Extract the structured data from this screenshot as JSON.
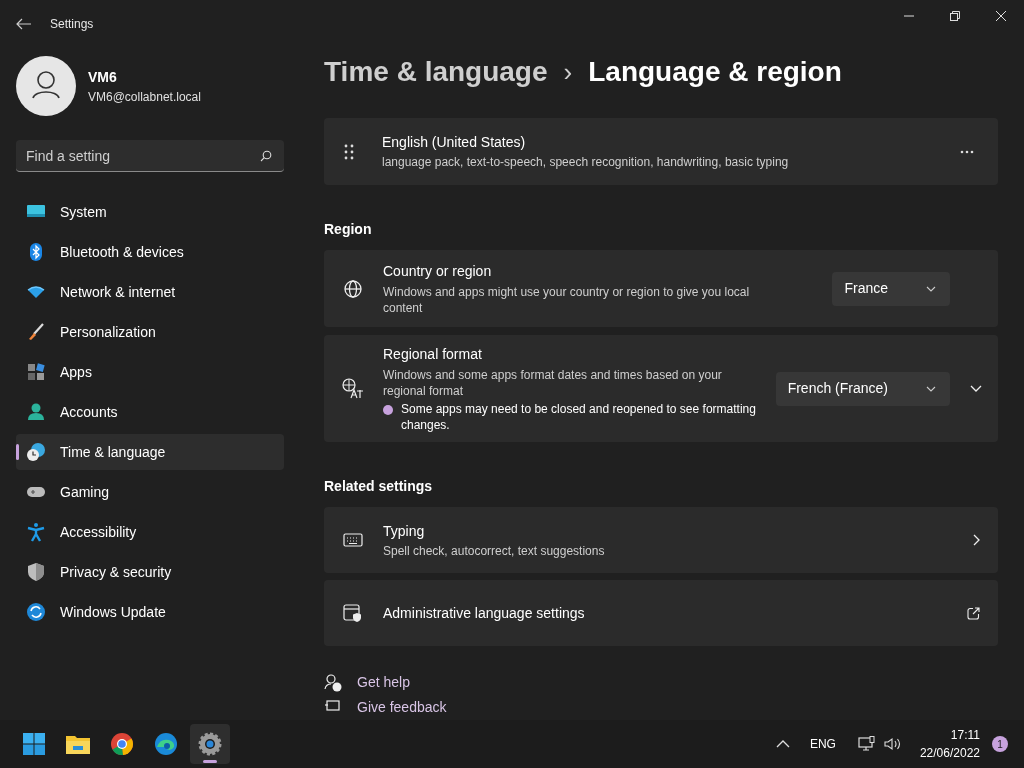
{
  "window": {
    "title": "Settings"
  },
  "user": {
    "name": "VM6",
    "email": "VM6@collabnet.local"
  },
  "search": {
    "placeholder": "Find a setting"
  },
  "sidebar": {
    "items": [
      {
        "label": "System",
        "selected": false
      },
      {
        "label": "Bluetooth & devices",
        "selected": false
      },
      {
        "label": "Network & internet",
        "selected": false
      },
      {
        "label": "Personalization",
        "selected": false
      },
      {
        "label": "Apps",
        "selected": false
      },
      {
        "label": "Accounts",
        "selected": false
      },
      {
        "label": "Time & language",
        "selected": true
      },
      {
        "label": "Gaming",
        "selected": false
      },
      {
        "label": "Accessibility",
        "selected": false
      },
      {
        "label": "Privacy & security",
        "selected": false
      },
      {
        "label": "Windows Update",
        "selected": false
      }
    ]
  },
  "breadcrumb": {
    "parent": "Time & language",
    "separator": "›",
    "current": "Language & region"
  },
  "language": {
    "title": "English (United States)",
    "description": "language pack, text-to-speech, speech recognition, handwriting, basic typing"
  },
  "region": {
    "heading": "Region",
    "rows": [
      {
        "title": "Country or region",
        "description": "Windows and apps might use your country or region to give you local content",
        "value": "France"
      },
      {
        "title": "Regional format",
        "description": "Windows and some apps format dates and times based on your regional format",
        "value": "French (France)",
        "expanded": false,
        "note": "Some apps may need to be closed and reopened to see formatting changes."
      }
    ]
  },
  "related": {
    "heading": "Related settings",
    "rows": [
      {
        "kind": "nav",
        "title": "Typing",
        "description": "Spell check, autocorrect, text suggestions"
      },
      {
        "kind": "external",
        "title": "Administrative language settings"
      }
    ]
  },
  "help_links": [
    "Get help",
    "Give feedback"
  ],
  "taskbar": {
    "apps": [
      {
        "selected": false
      },
      {
        "selected": false
      },
      {
        "selected": false
      },
      {
        "selected": true
      }
    ],
    "language": "ENG",
    "time": "17:11",
    "date": "22/06/2022",
    "notifications": "1"
  }
}
